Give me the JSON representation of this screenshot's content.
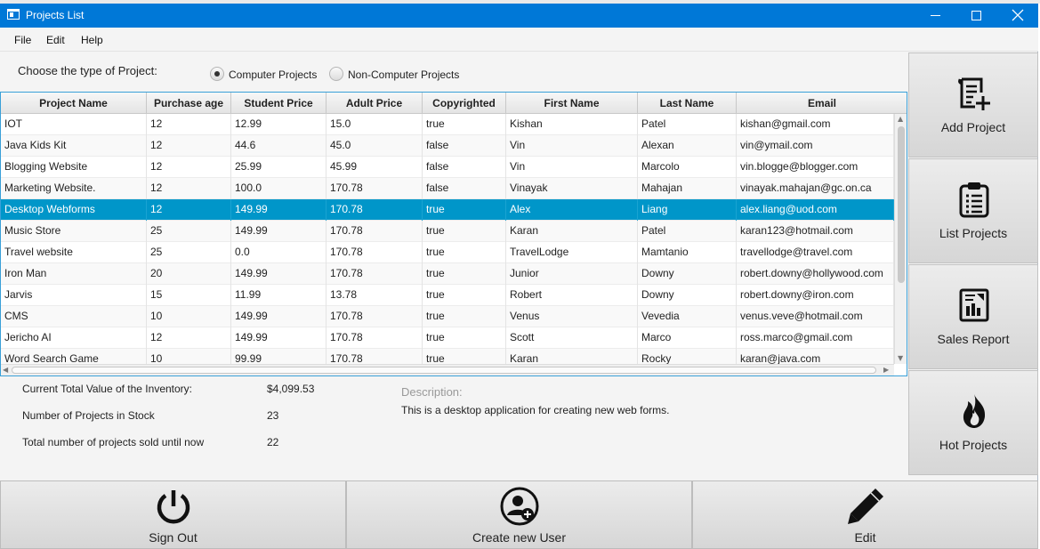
{
  "window": {
    "title": "Projects List"
  },
  "menu": [
    "File",
    "Edit",
    "Help"
  ],
  "type_selector": {
    "label": "Choose the type of Project:",
    "options": [
      {
        "label": "Computer Projects",
        "selected": true
      },
      {
        "label": "Non-Computer Projects",
        "selected": false
      }
    ]
  },
  "table": {
    "columns": [
      "Project Name",
      "Purchase age",
      "Student Price",
      "Adult Price",
      "Copyrighted",
      "First Name",
      "Last Name",
      "Email"
    ],
    "selected_row": 4,
    "rows": [
      [
        "IOT",
        "12",
        "12.99",
        "15.0",
        "true",
        "Kishan",
        "Patel",
        "kishan@gmail.com"
      ],
      [
        "Java Kids Kit",
        "12",
        "44.6",
        "45.0",
        "false",
        "Vin",
        "Alexan",
        "vin@ymail.com"
      ],
      [
        "Blogging Website",
        "12",
        "25.99",
        "45.99",
        "false",
        "Vin",
        "Marcolo",
        "vin.blogge@blogger.com"
      ],
      [
        "Marketing Website.",
        "12",
        "100.0",
        "170.78",
        "false",
        "Vinayak",
        "Mahajan",
        "vinayak.mahajan@gc.on.ca"
      ],
      [
        "Desktop Webforms",
        "12",
        "149.99",
        "170.78",
        "true",
        "Alex",
        "Liang",
        "alex.liang@uod.com"
      ],
      [
        "Music Store",
        "25",
        "149.99",
        "170.78",
        "true",
        "Karan",
        "Patel",
        "karan123@hotmail.com"
      ],
      [
        "Travel website",
        "25",
        "0.0",
        "170.78",
        "true",
        "TravelLodge",
        "Mamtanio",
        "travellodge@travel.com"
      ],
      [
        "Iron Man",
        "20",
        "149.99",
        "170.78",
        "true",
        "Junior",
        "Downy",
        "robert.downy@hollywood.com"
      ],
      [
        "Jarvis",
        "15",
        "11.99",
        "13.78",
        "true",
        "Robert",
        "Downy",
        "robert.downy@iron.com"
      ],
      [
        "CMS",
        "10",
        "149.99",
        "170.78",
        "true",
        "Venus",
        "Vevedia",
        "venus.veve@hotmail.com"
      ],
      [
        "Jericho AI",
        "12",
        "149.99",
        "170.78",
        "true",
        "Scott",
        "Marco",
        "ross.marco@gmail.com"
      ],
      [
        "Word Search Game",
        "10",
        "99.99",
        "170.78",
        "true",
        "Karan",
        "Rocky",
        "karan@java.com"
      ]
    ]
  },
  "stats": [
    {
      "label": "Current Total Value of the Inventory:",
      "value": "$4,099.53"
    },
    {
      "label": "Number of Projects in Stock",
      "value": "23"
    },
    {
      "label": "Total number of projects sold until now",
      "value": "22"
    }
  ],
  "description": {
    "label": "Description:",
    "text": "This is a desktop application for creating new web forms."
  },
  "side_buttons": [
    {
      "label": "Add Project",
      "icon": "add-document-icon"
    },
    {
      "label": "List Projects",
      "icon": "clipboard-list-icon"
    },
    {
      "label": "Sales Report",
      "icon": "report-chart-icon"
    },
    {
      "label": "Hot Projects",
      "icon": "flame-icon"
    }
  ],
  "bottom_buttons": [
    {
      "label": "Sign Out",
      "icon": "power-icon"
    },
    {
      "label": "Create new User",
      "icon": "add-user-icon"
    },
    {
      "label": "Edit",
      "icon": "pencil-icon"
    }
  ],
  "colors": {
    "titlebar": "#0078d7",
    "selection": "#0096c9",
    "table_border": "#3aa0d8"
  }
}
